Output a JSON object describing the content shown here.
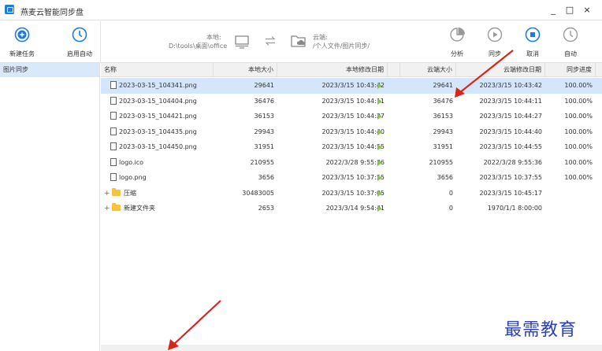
{
  "window": {
    "title": "燕麦云智能同步盘",
    "controls": {
      "minimize": "_",
      "maximize": "□",
      "close": "×"
    }
  },
  "toolbar": {
    "new_task": "新建任务",
    "enable_auto": "启用自动",
    "local_label": "本地:",
    "local_path": "D:\\tools\\桌面\\office",
    "cloud_label": "云端:",
    "cloud_path": "/个人文件/图片同步/",
    "analyze": "分析",
    "sync": "同步",
    "cancel": "取消",
    "auto": "自动"
  },
  "sidebar": {
    "tasks": [
      {
        "label": "图片同步"
      }
    ]
  },
  "table": {
    "headers": {
      "name": "名称",
      "local_size": "本地大小",
      "local_modified": "本地修改日期",
      "cloud_size": "云端大小",
      "cloud_modified": "云端修改日期",
      "progress": "同步进度"
    },
    "rows": [
      {
        "type": "file",
        "name": "2023-03-15_104341.png",
        "local_size": "29641",
        "local_modified": "2023/3/15 10:43:42",
        "cloud_size": "29641",
        "cloud_modified": "2023/3/15 10:43:42",
        "progress": "100.00%",
        "selected": true
      },
      {
        "type": "file",
        "name": "2023-03-15_104404.png",
        "local_size": "36476",
        "local_modified": "2023/3/15 10:44:11",
        "cloud_size": "36476",
        "cloud_modified": "2023/3/15 10:44:11",
        "progress": "100.00%"
      },
      {
        "type": "file",
        "name": "2023-03-15_104421.png",
        "local_size": "36153",
        "local_modified": "2023/3/15 10:44:27",
        "cloud_size": "36153",
        "cloud_modified": "2023/3/15 10:44:27",
        "progress": "100.00%"
      },
      {
        "type": "file",
        "name": "2023-03-15_104435.png",
        "local_size": "29943",
        "local_modified": "2023/3/15 10:44:40",
        "cloud_size": "29943",
        "cloud_modified": "2023/3/15 10:44:40",
        "progress": "100.00%"
      },
      {
        "type": "file",
        "name": "2023-03-15_104450.png",
        "local_size": "31951",
        "local_modified": "2023/3/15 10:44:55",
        "cloud_size": "31951",
        "cloud_modified": "2023/3/15 10:44:55",
        "progress": "100.00%"
      },
      {
        "type": "file",
        "name": "logo.ico",
        "local_size": "210955",
        "local_modified": "2022/3/28 9:55:36",
        "cloud_size": "210955",
        "cloud_modified": "2022/3/28 9:55:36",
        "progress": "100.00%"
      },
      {
        "type": "file",
        "name": "logo.png",
        "local_size": "3656",
        "local_modified": "2023/3/15 10:37:55",
        "cloud_size": "3656",
        "cloud_modified": "2023/3/15 10:37:55",
        "progress": "100.00%"
      },
      {
        "type": "folder",
        "expander": "+",
        "name": "压缩",
        "local_size": "30483005",
        "local_modified": "2023/3/15 10:37:05",
        "cloud_size": "0",
        "cloud_modified": "2023/3/15 10:45:17",
        "progress": ""
      },
      {
        "type": "folder",
        "expander": "+",
        "name": "新建文件夹",
        "local_size": "2653",
        "local_modified": "2023/3/14 9:54:41",
        "cloud_size": "0",
        "cloud_modified": "1970/1/1 8:00:00",
        "progress": ""
      }
    ]
  },
  "watermark": "最需教育",
  "colors": {
    "accent": "#1e7be0",
    "selected_row": "#d4e6fb",
    "annotation_arrow": "#d9261c"
  }
}
